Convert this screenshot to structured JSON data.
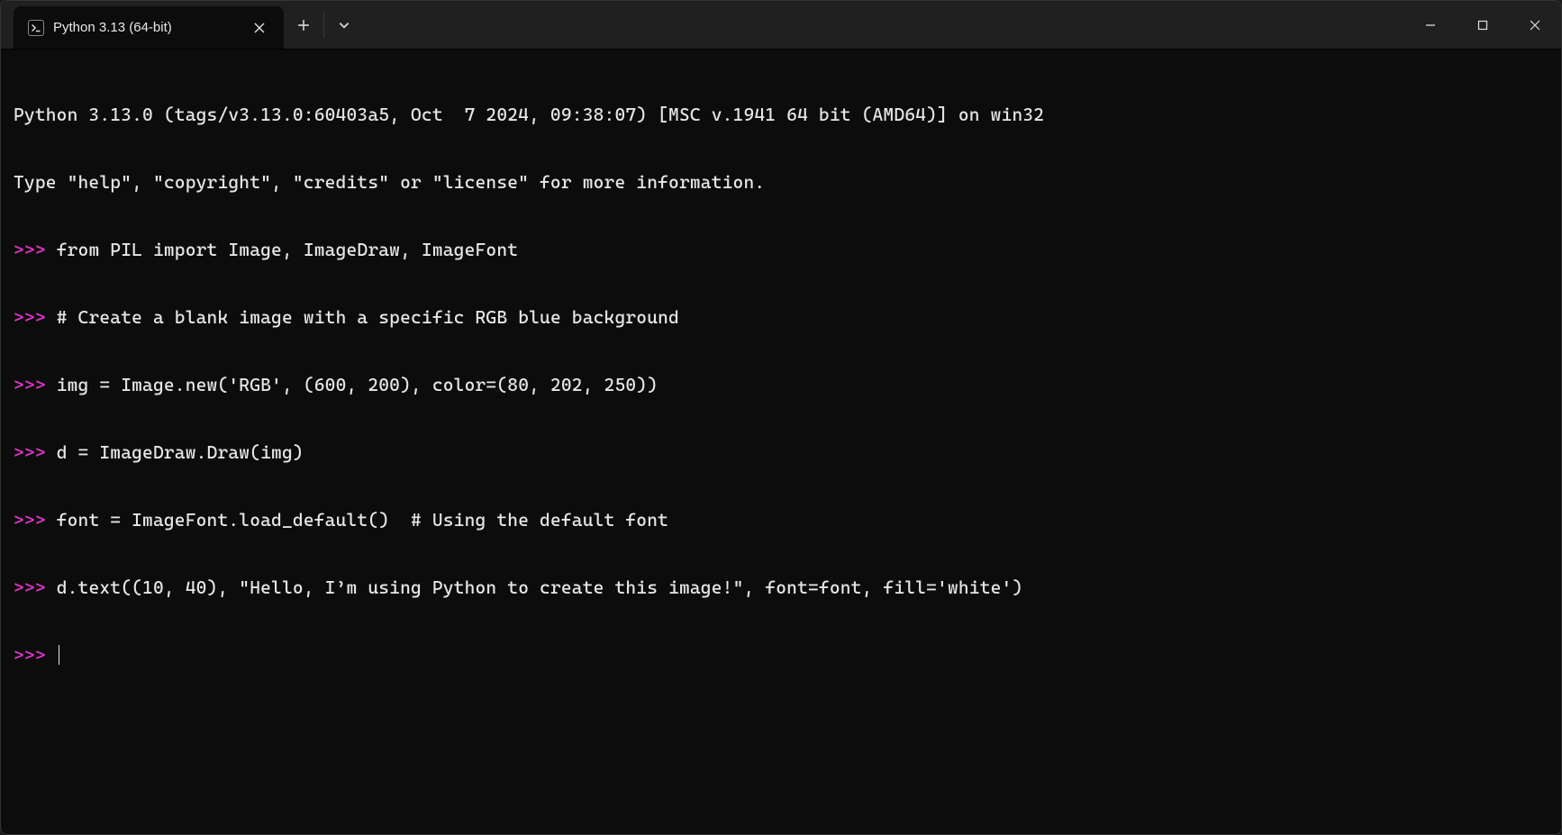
{
  "tab": {
    "title": "Python 3.13 (64-bit)"
  },
  "banner": {
    "line1": "Python 3.13.0 (tags/v3.13.0:60403a5, Oct  7 2024, 09:38:07) [MSC v.1941 64 bit (AMD64)] on win32",
    "line2": "Type \"help\", \"copyright\", \"credits\" or \"license\" for more information."
  },
  "prompt": ">>> ",
  "lines": [
    "from PIL import Image, ImageDraw, ImageFont",
    "# Create a blank image with a specific RGB blue background",
    "img = Image.new('RGB', (600, 200), color=(80, 202, 250))",
    "d = ImageDraw.Draw(img)",
    "font = ImageFont.load_default()  # Using the default font",
    "d.text((10, 40), \"Hello, I’m using Python to create this image!\", font=font, fill='white')"
  ]
}
